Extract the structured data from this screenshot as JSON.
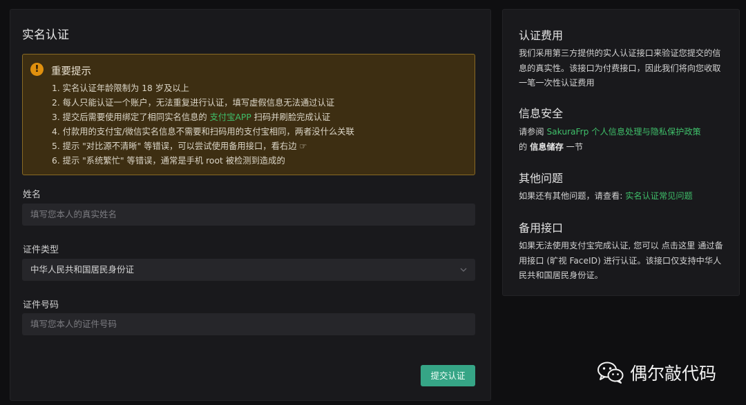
{
  "form": {
    "title": "实名认证",
    "notice": {
      "title": "重要提示",
      "items": {
        "i1": "1. 实名认证年龄限制为 18 岁及以上",
        "i2": "2. 每人只能认证一个账户，无法重复进行认证，填写虚假信息无法通过认证",
        "i3_pre": "3. 提交后需要使用绑定了相同实名信息的 ",
        "i3_link": "支付宝APP",
        "i3_post": " 扫码并刷脸完成认证",
        "i4": "4. 付款用的支付宝/微信实名信息不需要和扫码用的支付宝相同，两者没什么关联",
        "i5": "5. 提示 \"对比源不清晰\" 等错误，可以尝试使用备用接口，看右边 ☞",
        "i6": "6. 提示 \"系统繁忙\" 等错误，通常是手机 root 被检测到造成的"
      }
    },
    "name_label": "姓名",
    "name_placeholder": "填写您本人的真实姓名",
    "id_type_label": "证件类型",
    "id_type_value": "中华人民共和国居民身份证",
    "id_number_label": "证件号码",
    "id_number_placeholder": "填写您本人的证件号码",
    "submit_label": "提交认证"
  },
  "side": {
    "fee_title": "认证费用",
    "fee_text": "我们采用第三方提供的实人认证接口来验证您提交的信息的真实性。该接口为付费接口，因此我们将向您收取一笔一次性认证费用",
    "security_title": "信息安全",
    "security_pre": "请参阅 ",
    "security_link": "SakuraFrp 个人信息处理与隐私保护政策",
    "security_mid": " 的 ",
    "security_bold": "信息储存",
    "security_post": " 一节",
    "other_title": "其他问题",
    "other_pre": "如果还有其他问题，请查看: ",
    "other_link": "实名认证常见问题",
    "backup_title": "备用接口",
    "backup_text": "如果无法使用支付宝完成认证, 您可以 点击这里 通过备用接口 (旷视 FaceID) 进行认证。该接口仅支持中华人民共和国居民身份证。"
  },
  "watermark": {
    "text": "偶尔敲代码",
    "icon": "wechat-icon"
  },
  "colors": {
    "accent": "#36a586",
    "link": "#3fbf6a",
    "warning": "#e0900e"
  }
}
